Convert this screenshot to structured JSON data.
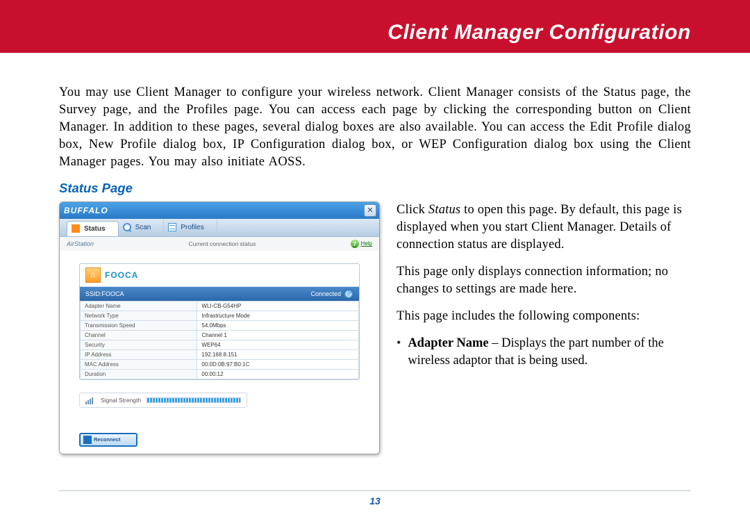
{
  "banner": {
    "title": "Client Manager Configuration"
  },
  "intro_text": "You may use Client Manager to configure your wireless network. Client Manager consists of the Status page, the Survey page, and the Profiles page. You can access each page by clicking the corresponding button on Client Manager. In addition to these pages, several dialog boxes are also available. You can access the Edit Profile dialog box, New Profile dialog box, IP Configuration dialog box, or WEP Configuration dialog box using the Client Manager pages.  You may also initiate AOSS.",
  "subhead": "Status Page",
  "right": {
    "p1a": "Click ",
    "p1_status": "Status",
    "p1b": " to open this page. By default, this page is displayed when you start Client Manager. Details of connection status are displayed.",
    "p2": "This page only displays connection information; no changes to settings are made here.",
    "p3": "This page includes the following components:",
    "bullet_lead": "Adapter Name",
    "bullet_rest": " – Displays the part number of the wireless adaptor that is being used."
  },
  "cm": {
    "brand": "BUFFALO",
    "close_glyph": "✕",
    "tabs": {
      "status": "Status",
      "scan": "Scan",
      "profiles": "Profiles"
    },
    "substrip": {
      "airstation": "AirStation",
      "ccs": "Current connection status",
      "help": "Help",
      "qmark": "?"
    },
    "network_name": "FOOCA",
    "ssid_label": "SSID:FOOCA",
    "connected": "Connected",
    "rows": [
      {
        "k": "Adapter Name",
        "v": "WLI-CB-G54HP"
      },
      {
        "k": "Network Type",
        "v": "Infrastructure Mode"
      },
      {
        "k": "Transmission Speed",
        "v": "54.0Mbps"
      },
      {
        "k": "Channel",
        "v": "Channel 1"
      },
      {
        "k": "Security",
        "v": "WEP64"
      },
      {
        "k": "IP Address",
        "v": "192.168.8.151"
      },
      {
        "k": "MAC Address",
        "v": "00:0D:0B:97:B0:1C"
      },
      {
        "k": "Duration",
        "v": "00:00:12"
      }
    ],
    "signal_label": "Signal Strength",
    "reconnect": "Reconnect"
  },
  "page_number": "13"
}
